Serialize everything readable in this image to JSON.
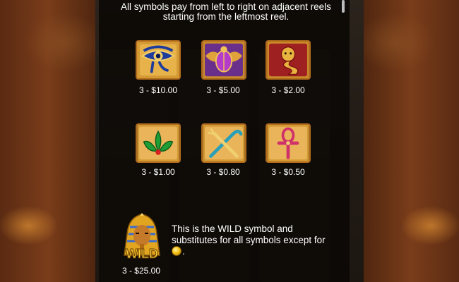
{
  "paytable": {
    "intro_text": "All symbols pay from left to right on adjacent reels starting from the leftmost reel.",
    "symbols": [
      {
        "name": "Eye of Horus",
        "icon": "eye-of-horus-icon",
        "payout": "3 - $10.00"
      },
      {
        "name": "Scarab",
        "icon": "scarab-icon",
        "payout": "3 - $5.00"
      },
      {
        "name": "Cobra",
        "icon": "cobra-icon",
        "payout": "3 - $2.00"
      },
      {
        "name": "Lotus",
        "icon": "lotus-icon",
        "payout": "3 - $1.00"
      },
      {
        "name": "Crook and Flail",
        "icon": "crook-and-flail-icon",
        "payout": "3 - $0.80"
      },
      {
        "name": "Ankh",
        "icon": "ankh-icon",
        "payout": "3 - $0.50"
      }
    ],
    "wild": {
      "icon": "wild-pharaoh-icon",
      "label": "WILD",
      "payout": "3 - $25.00",
      "description": "This is the WILD symbol and substitutes for all symbols except for",
      "description_end": ".",
      "exception_icon": "gold-coin-icon"
    }
  },
  "colors": {
    "tile_border": "#b06a1c",
    "gold": "#f2c21b",
    "text": "#ffffff"
  }
}
